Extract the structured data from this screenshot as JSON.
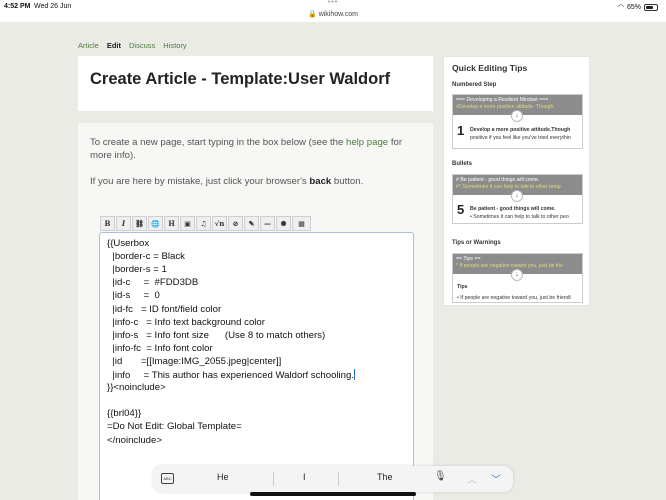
{
  "status": {
    "time": "4:52 PM",
    "date": "Wed 26 Jun",
    "url": "wikihow.com",
    "battery": "65%",
    "battery_level": 0.65
  },
  "tabs": [
    {
      "label": "Article"
    },
    {
      "label": "Edit"
    },
    {
      "label": "Discuss"
    },
    {
      "label": "History"
    }
  ],
  "title": "Create Article - Template:User Waldorf",
  "intro": {
    "before_link": "To create a new page, start typing in the box below (see the ",
    "link": "help page",
    "after_link": " for more info).",
    "mistake_before": "If you are here by mistake, just click your browser's ",
    "mistake_bold": "back",
    "mistake_after": " button."
  },
  "toolbar": {
    "buttons": [
      "B",
      "I",
      "Ab",
      "Aa",
      "H",
      "img",
      "media",
      "√n",
      "nowiki",
      "sig",
      "—",
      "gallery",
      "table"
    ]
  },
  "editor": {
    "lines": [
      "{{Userbox",
      "  |border-c = Black",
      "  |border-s = 1",
      "  |id-c     =  #FDD3DB",
      "  |id-s     =  0",
      "  |id-fc   = ID font/field color",
      "  |info-c   = Info text background color",
      "  |info-s   = Info font size      (Use 8 to match others)",
      "  |info-fc  = Info font color",
      "  |id       =[[Image:IMG_2055.jpeg|center]]",
      "  |info     = This author has experienced Waldorf schooling.",
      "}}<noinclude>",
      "",
      "{{brl04}}",
      "=Do Not Edit: Global Template=",
      "</noinclude>"
    ]
  },
  "sidebar": {
    "title": "Quick Editing Tips",
    "sections": [
      {
        "label": "Numbered Step",
        "top1": "=== Developing a Resilient Mindset ===",
        "top2": "#Develop a more positive attitude. Though",
        "number": "1",
        "bottom1": "Develop a more positive attitude.Though",
        "bottom2": "positive if you feel like you've tried everythin"
      },
      {
        "label": "Bullets",
        "top1": "# Be patient - good things will come.",
        "top2": "#* Sometimes it can help to talk to other peop",
        "number": "5",
        "bottom1": "Be patient - good things will come.",
        "bottom2": "• Sometimes it can help to talk to other peo"
      },
      {
        "label": "Tips or Warnings",
        "top1": "== Tips ==",
        "top2": "* If people are negative toward you, just be frie",
        "number": "",
        "bottom1": "Tips",
        "bottom2": "• If people are negative toward you, just be friendl"
      }
    ]
  },
  "keyboard": {
    "suggestions": [
      "He",
      "I",
      "The"
    ]
  },
  "colors": {
    "link_green": "#4c7a3d",
    "editor_border": "#a9bfdc",
    "background": "#ebebe6"
  }
}
